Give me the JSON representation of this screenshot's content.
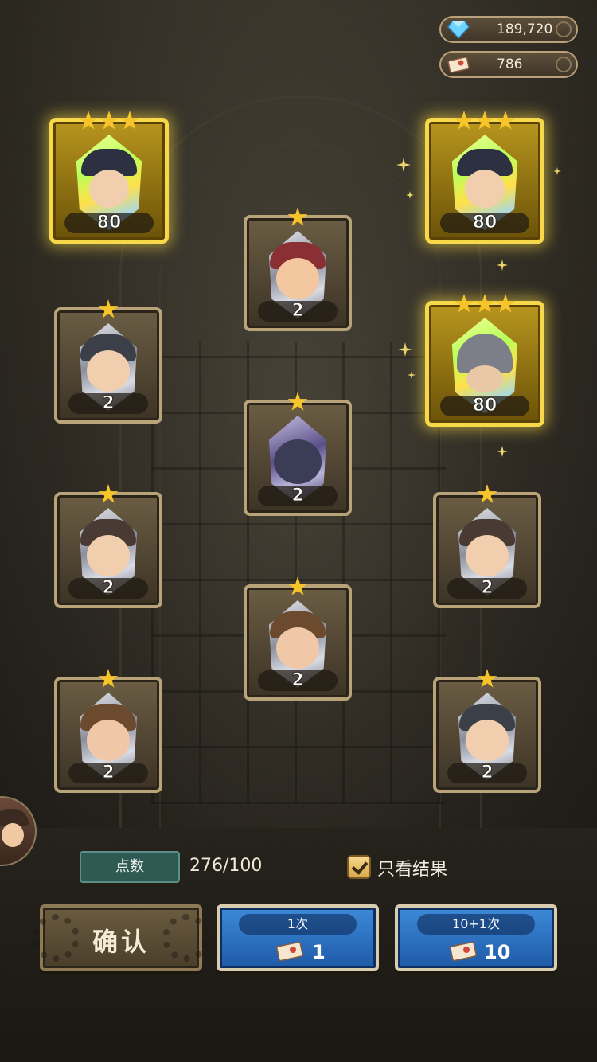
{
  "currency": {
    "gems": "189,720",
    "tickets": "786"
  },
  "cards": [
    {
      "id": "c1",
      "stars": 3,
      "count": "80",
      "rarity": "gold"
    },
    {
      "id": "c2",
      "stars": 3,
      "count": "80",
      "rarity": "gold"
    },
    {
      "id": "c3",
      "stars": 1,
      "count": "2",
      "rarity": "normal"
    },
    {
      "id": "c4",
      "stars": 1,
      "count": "2",
      "rarity": "normal"
    },
    {
      "id": "c5",
      "stars": 3,
      "count": "80",
      "rarity": "gold"
    },
    {
      "id": "c6",
      "stars": 1,
      "count": "2",
      "rarity": "normal"
    },
    {
      "id": "c7",
      "stars": 1,
      "count": "2",
      "rarity": "normal"
    },
    {
      "id": "c8",
      "stars": 1,
      "count": "2",
      "rarity": "normal"
    },
    {
      "id": "c9",
      "stars": 1,
      "count": "2",
      "rarity": "normal"
    },
    {
      "id": "c10",
      "stars": 1,
      "count": "2",
      "rarity": "normal"
    },
    {
      "id": "c11",
      "stars": 1,
      "count": "2",
      "rarity": "normal"
    }
  ],
  "points": {
    "label": "点数",
    "value": "276/100"
  },
  "results_only": {
    "label": "只看结果",
    "checked": true
  },
  "buttons": {
    "confirm": "确认",
    "draw_single": {
      "label": "1次",
      "cost": "1"
    },
    "draw_ten": {
      "label": "10+1次",
      "cost": "10"
    }
  },
  "colors": {
    "gold_border": "#f6d84a",
    "normal_border": "#b9a47a",
    "draw_button": "#2b72c4",
    "points_bg": "#2e5a53"
  }
}
